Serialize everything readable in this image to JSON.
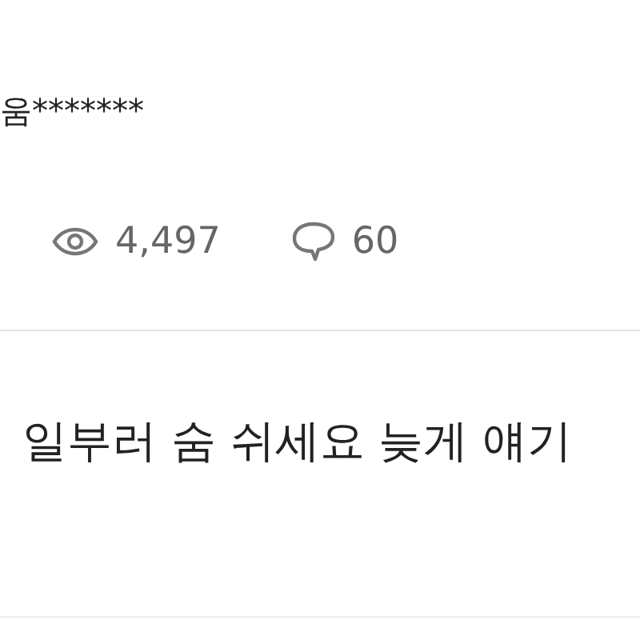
{
  "post": {
    "author": "움*******",
    "views": "4,497",
    "comments": "60"
  },
  "comment": {
    "text": "일부러 숨 쉬세요 늦게 얘기"
  }
}
